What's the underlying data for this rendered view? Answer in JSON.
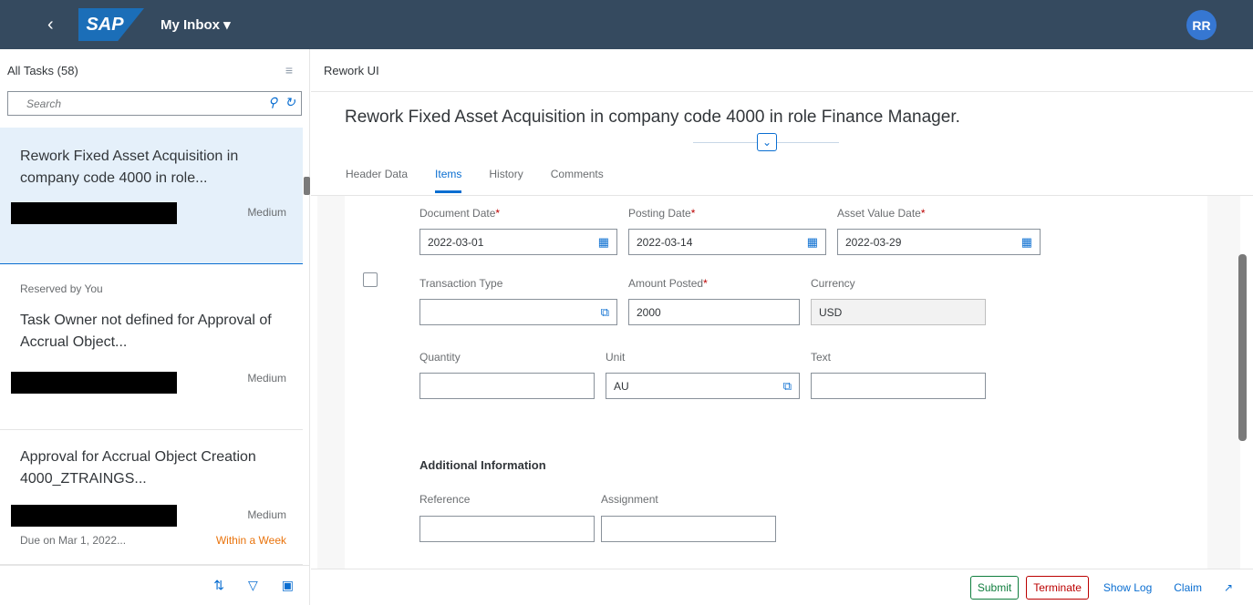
{
  "shell": {
    "back_icon": "chevron-left-icon",
    "logo": "SAP",
    "title": "My Inbox ▾",
    "avatar": "RR"
  },
  "master": {
    "header": "All Tasks (58)",
    "search_placeholder": "Search",
    "items": [
      {
        "title": "Rework Fixed Asset Acquisition in company code 4000 in role...",
        "priority": "Medium",
        "reserved": "",
        "due": "",
        "due_status": ""
      },
      {
        "title": "Task Owner not defined for Approval of Accrual Object...",
        "priority": "Medium",
        "reserved": "Reserved by You",
        "due": "",
        "due_status": ""
      },
      {
        "title": "Approval for Accrual Object Creation 4000_ZTRAINGS...",
        "priority": "Medium",
        "reserved": "",
        "due": "Due on Mar 1, 2022...",
        "due_status": "Within a Week"
      }
    ]
  },
  "detail": {
    "bar_title": "Rework UI",
    "object_title": "Rework Fixed Asset Acquisition in company code 4000 in role Finance Manager.",
    "tabs": [
      "Header Data",
      "Items",
      "History",
      "Comments"
    ],
    "active_tab": "Items",
    "form": {
      "document_date_label": "Document Date",
      "document_date": "2022-03-01",
      "posting_date_label": "Posting Date",
      "posting_date": "2022-03-14",
      "asset_value_date_label": "Asset Value Date",
      "asset_value_date": "2022-03-29",
      "transaction_type_label": "Transaction Type",
      "transaction_type": "",
      "amount_posted_label": "Amount Posted",
      "amount_posted": "2000",
      "currency_label": "Currency",
      "currency": "USD",
      "quantity_label": "Quantity",
      "quantity": "",
      "unit_label": "Unit",
      "unit": "AU",
      "text_label": "Text",
      "text": "",
      "additional_info_title": "Additional Information",
      "reference_label": "Reference",
      "reference": "",
      "assignment_label": "Assignment",
      "assignment": ""
    },
    "footer": {
      "submit": "Submit",
      "terminate": "Terminate",
      "show_log": "Show Log",
      "claim": "Claim"
    }
  },
  "colors": {
    "shell": "#354a5f",
    "accent": "#0a6ed1",
    "selected_item": "#e5f0fa",
    "accept": "#107e3e",
    "reject": "#bb0000",
    "warning": "#e9730c"
  }
}
